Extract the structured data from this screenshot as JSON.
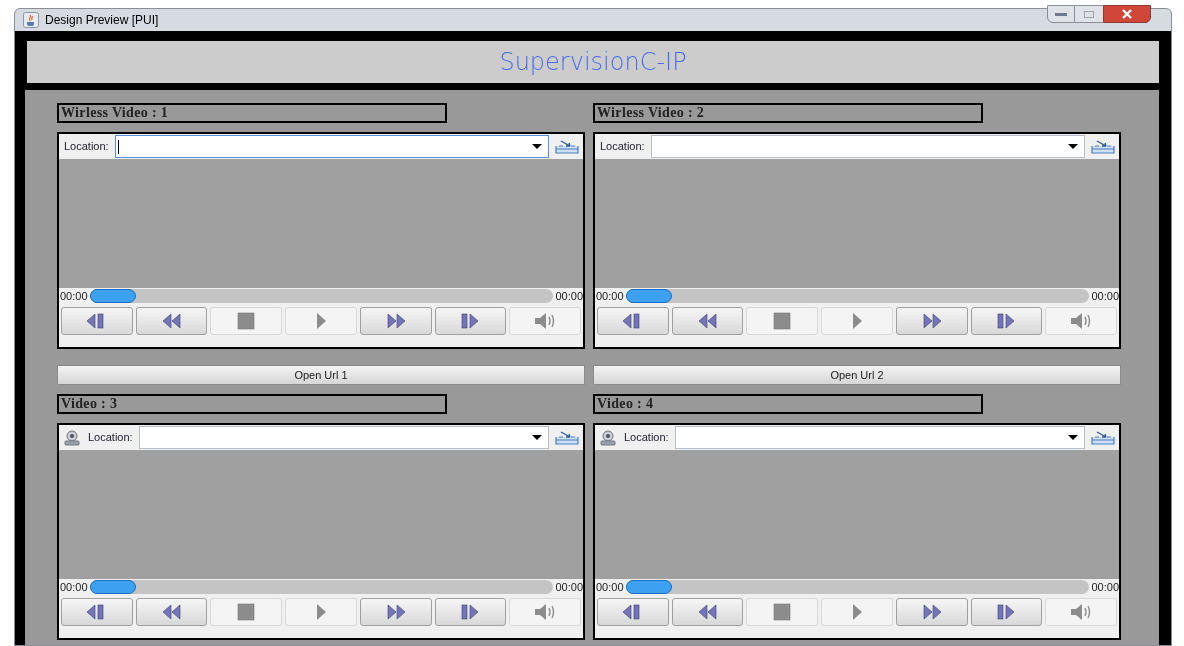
{
  "window": {
    "title": "Design Preview [PUI]"
  },
  "header": {
    "title": "SupervisionC-IP"
  },
  "panels": [
    {
      "label": "Wirless Video : 1",
      "kind": "wireless",
      "location_label": "Location:",
      "location_focused": true,
      "time_start": "00:00",
      "time_end": "00:00",
      "level": 0.1,
      "open_url_button": "Open Url 1"
    },
    {
      "label": "Wirless Video : 2",
      "kind": "wireless",
      "location_label": "Location:",
      "location_focused": false,
      "time_start": "00:00",
      "time_end": "00:00",
      "level": 0.1,
      "open_url_button": "Open Url 2"
    },
    {
      "label": "Video : 3",
      "kind": "camera",
      "location_label": "Location:",
      "location_focused": false,
      "time_start": "00:00",
      "time_end": "00:00",
      "level": 0.1
    },
    {
      "label": "Video : 4",
      "kind": "camera",
      "location_label": "Location:",
      "location_focused": false,
      "time_start": "00:00",
      "time_end": "00:00",
      "level": 0.1
    }
  ],
  "controls": [
    {
      "kind": "step-back",
      "disabled": false
    },
    {
      "kind": "rewind",
      "disabled": false
    },
    {
      "kind": "stop",
      "disabled": true
    },
    {
      "kind": "play",
      "disabled": true
    },
    {
      "kind": "fast-forward",
      "disabled": false
    },
    {
      "kind": "step-forward",
      "disabled": false
    },
    {
      "kind": "volume",
      "disabled": true
    }
  ]
}
